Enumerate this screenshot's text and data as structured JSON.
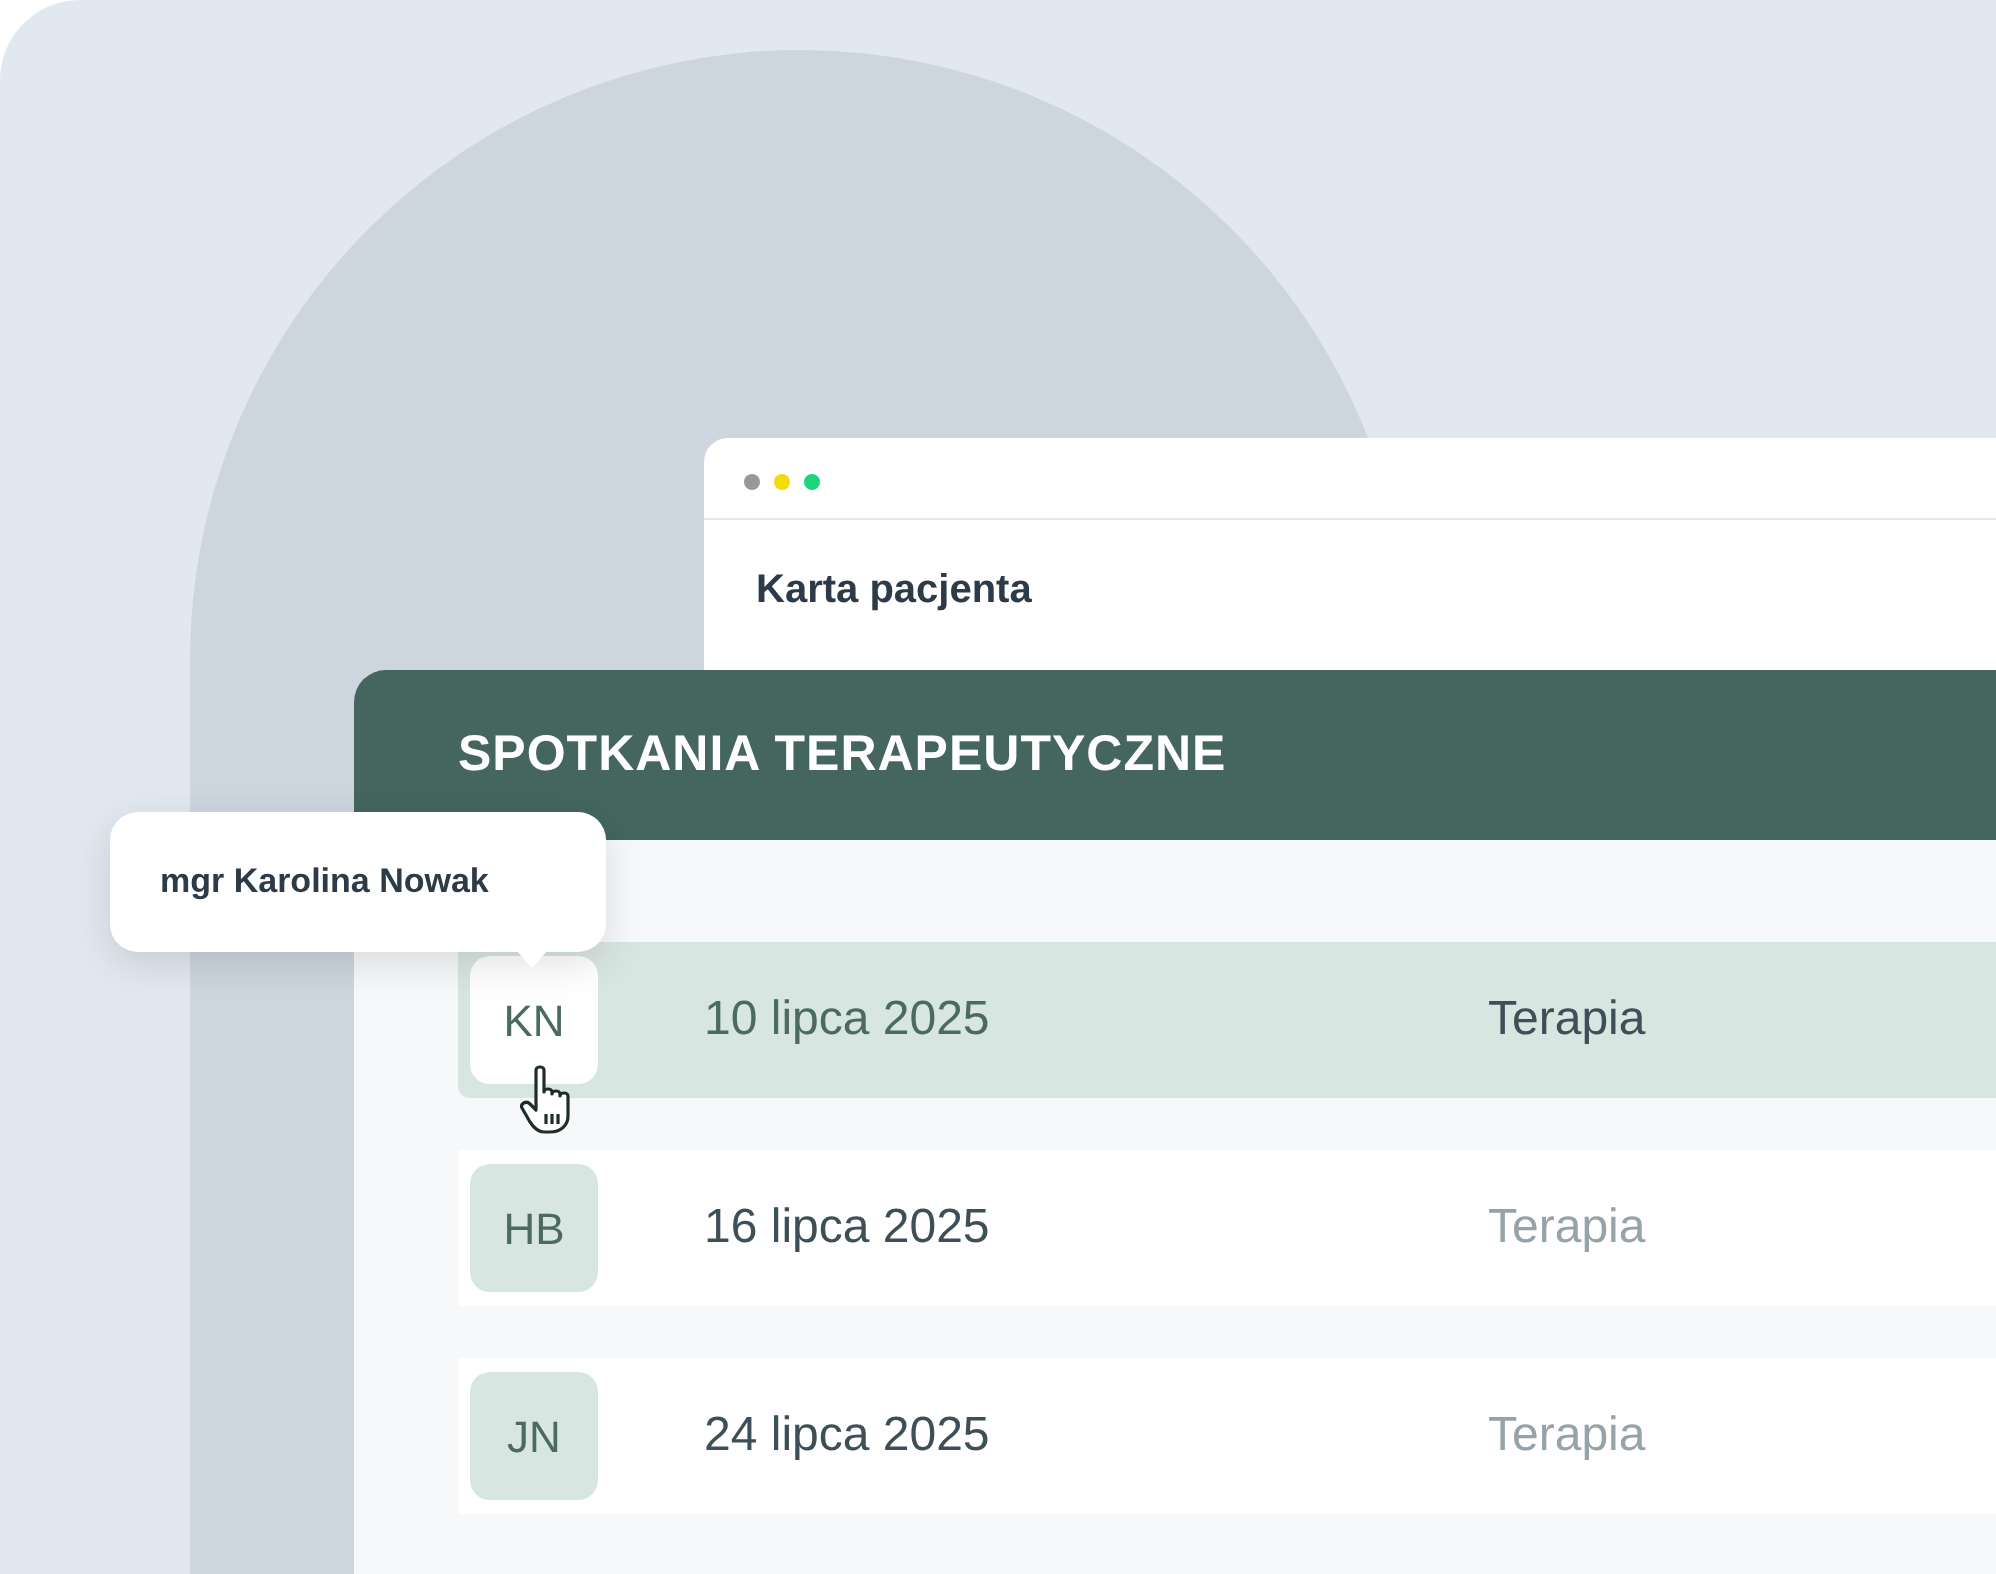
{
  "window": {
    "title": "Karta pacjenta"
  },
  "panel": {
    "title": "SPOTKANIA TERAPEUTYCZNE"
  },
  "tooltip": {
    "text": "mgr Karolina Nowak"
  },
  "sessions": [
    {
      "initials": "KN",
      "date": "10 lipca 2025",
      "type": "Terapia",
      "selected": true
    },
    {
      "initials": "HB",
      "date": "16 lipca 2025",
      "type": "Terapia",
      "selected": false
    },
    {
      "initials": "JN",
      "date": "24 lipca 2025",
      "type": "Terapia",
      "selected": false
    }
  ]
}
